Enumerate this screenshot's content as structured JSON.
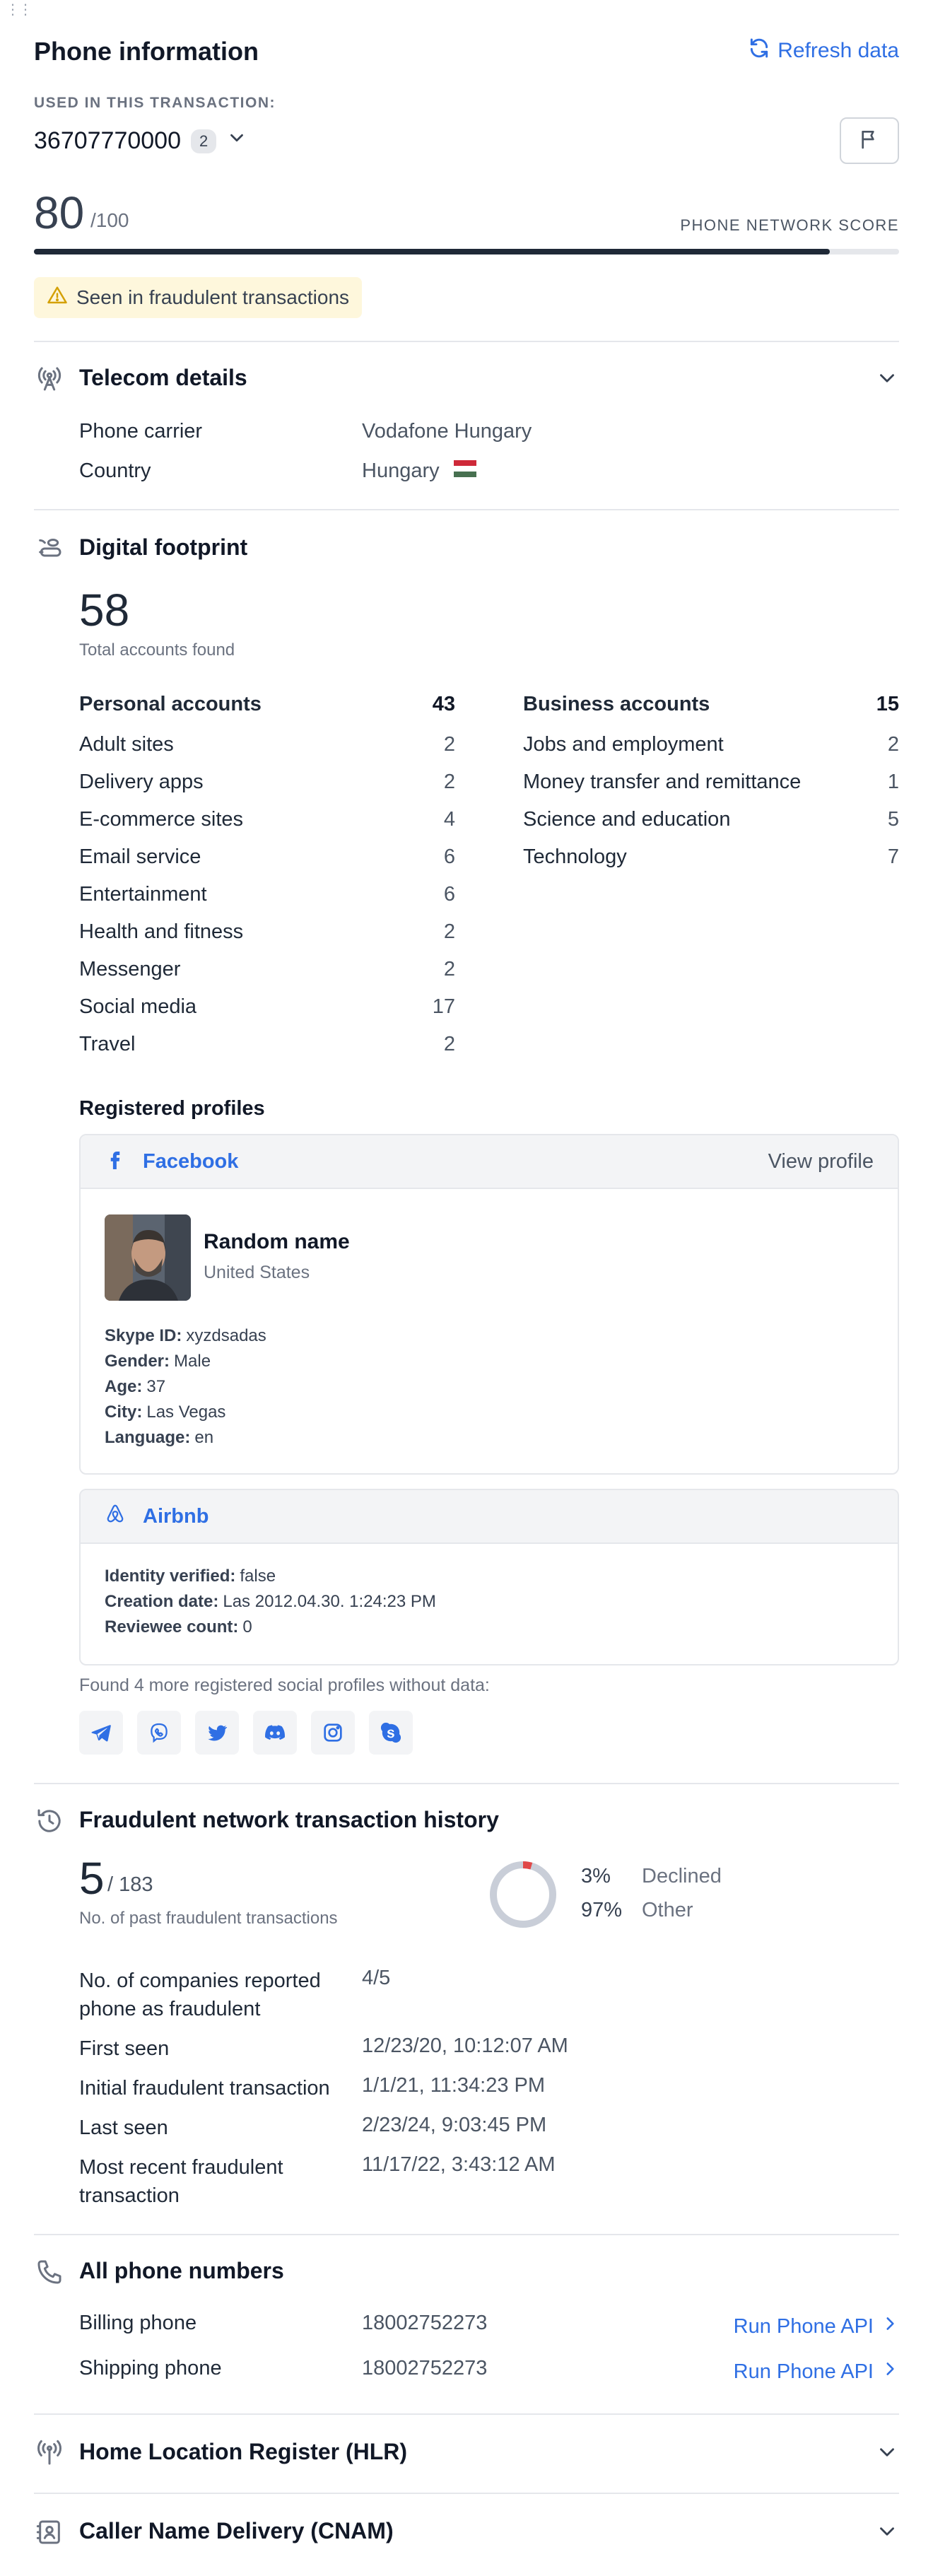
{
  "header": {
    "title": "Phone information",
    "refresh_label": "Refresh data"
  },
  "transaction": {
    "used_label": "USED IN THIS TRANSACTION:",
    "phone_number": "36707770000",
    "phone_count": "2"
  },
  "score": {
    "value": "80",
    "max": "/100",
    "label": "PHONE NETWORK SCORE",
    "fraction": 0.92
  },
  "warning": {
    "text": "Seen in fraudulent transactions"
  },
  "telecom": {
    "title": "Telecom details",
    "carrier_label": "Phone carrier",
    "carrier_value": "Vodafone Hungary",
    "country_label": "Country",
    "country_value": "Hungary",
    "flag_colors": [
      "#ce2939",
      "#ffffff",
      "#477050"
    ]
  },
  "footprint": {
    "title": "Digital footprint",
    "total": "58",
    "total_label": "Total accounts found",
    "personal": {
      "label": "Personal accounts",
      "count": "43",
      "items": [
        {
          "label": "Adult sites",
          "count": "2"
        },
        {
          "label": "Delivery apps",
          "count": "2"
        },
        {
          "label": "E-commerce sites",
          "count": "4"
        },
        {
          "label": "Email service",
          "count": "6"
        },
        {
          "label": "Entertainment",
          "count": "6"
        },
        {
          "label": "Health and fitness",
          "count": "2"
        },
        {
          "label": "Messenger",
          "count": "2"
        },
        {
          "label": "Social media",
          "count": "17"
        },
        {
          "label": "Travel",
          "count": "2"
        }
      ]
    },
    "business": {
      "label": "Business accounts",
      "count": "15",
      "items": [
        {
          "label": "Jobs and employment",
          "count": "2"
        },
        {
          "label": "Money transfer and remittance",
          "count": "1"
        },
        {
          "label": "Science and education",
          "count": "5"
        },
        {
          "label": "Technology",
          "count": "7"
        }
      ]
    },
    "registered_title": "Registered profiles",
    "facebook": {
      "name": "Facebook",
      "view_label": "View profile",
      "profile_name": "Random name",
      "profile_country": "United States",
      "attrs": [
        {
          "k": "Skype ID:",
          "v": "xyzdsadas"
        },
        {
          "k": "Gender:",
          "v": "Male"
        },
        {
          "k": "Age:",
          "v": "37"
        },
        {
          "k": "City:",
          "v": "Las Vegas"
        },
        {
          "k": "Language:",
          "v": "en"
        }
      ]
    },
    "airbnb": {
      "name": "Airbnb",
      "attrs": [
        {
          "k": "Identity verified:",
          "v": "false"
        },
        {
          "k": "Creation date:",
          "v": "Las 2012.04.30. 1:24:23 PM"
        },
        {
          "k": "Reviewee count:",
          "v": "0"
        }
      ]
    },
    "more_text": "Found 4 more registered social profiles without data:",
    "social_icons": [
      "telegram-icon",
      "viber-icon",
      "twitter-icon",
      "discord-icon",
      "instagram-icon",
      "skype-icon"
    ]
  },
  "history": {
    "title": "Fraudulent network transaction history",
    "count": "5",
    "total": "/ 183",
    "sub": "No. of past fraudulent transactions",
    "declined_pct": "3%",
    "declined_label": "Declined",
    "other_pct": "97%",
    "other_label": "Other",
    "declined_fraction": 0.03,
    "colors": {
      "declined": "#e04848",
      "other": "#c9ced8"
    },
    "rows": [
      {
        "label": "No. of companies reported phone as fraudulent",
        "value": "4/5"
      },
      {
        "label": "First seen",
        "value": "12/23/20, 10:12:07 AM"
      },
      {
        "label": "Initial fraudulent transaction",
        "value": "1/1/21, 11:34:23 PM"
      },
      {
        "label": "Last seen",
        "value": "2/23/24, 9:03:45 PM"
      },
      {
        "label": "Most recent fraudulent transaction",
        "value": "11/17/22, 3:43:12 AM"
      }
    ]
  },
  "phones": {
    "title": "All phone numbers",
    "billing_label": "Billing phone",
    "billing_value": "18002752273",
    "shipping_label": "Shipping phone",
    "shipping_value": "18002752273",
    "run_label": "Run Phone API"
  },
  "hlr": {
    "title": "Home Location Register (HLR)"
  },
  "cnam": {
    "title": "Caller Name Delivery (CNAM)"
  },
  "accent": "#2f6fe4"
}
